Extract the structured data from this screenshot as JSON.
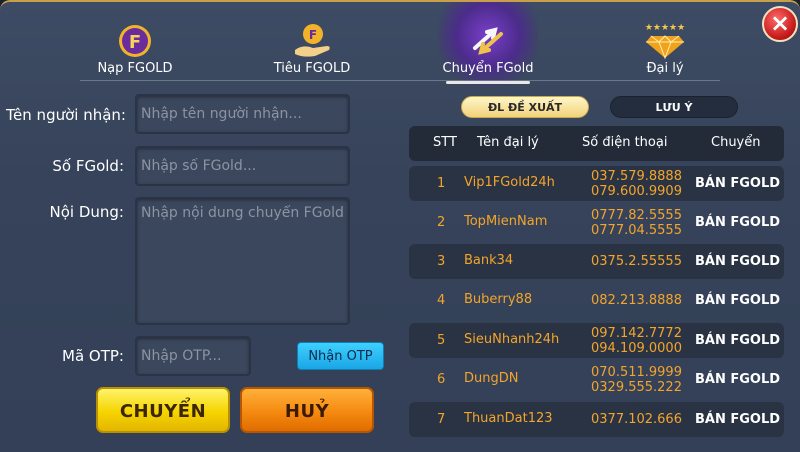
{
  "tabs": [
    {
      "label": "Nạp FGOLD",
      "icon": "fgold-coin-icon",
      "active": false
    },
    {
      "label": "Tiêu FGOLD",
      "icon": "hand-coin-icon",
      "active": false
    },
    {
      "label": "Chuyển FGold",
      "icon": "transfer-arrows-icon",
      "active": true
    },
    {
      "label": "Đại lý",
      "icon": "diamond-stars-icon",
      "active": false
    }
  ],
  "form": {
    "recipient": {
      "label": "Tên người nhận:",
      "placeholder": "Nhập tên người nhận..."
    },
    "amount": {
      "label": "Số FGold:",
      "placeholder": "Nhập số FGold..."
    },
    "content": {
      "label": "Nội Dung:",
      "placeholder": "Nhập nội dung chuyển FGold"
    },
    "otp": {
      "label": "Mã OTP:",
      "placeholder": "Nhập OTP...",
      "button": "Nhận OTP"
    },
    "submit": "CHUYỂN",
    "cancel": "HUỶ"
  },
  "subtabs": {
    "suggested": "ĐL ĐỀ XUẤT",
    "note": "LƯU Ý"
  },
  "table": {
    "headers": {
      "stt": "STT",
      "name": "Tên đại lý",
      "phone": "Số điện thoại",
      "action": "Chuyển"
    },
    "rows": [
      {
        "stt": "1",
        "name": "Vip1FGold24h",
        "phones": [
          "037.579.8888",
          "079.600.9909"
        ],
        "action": "BÁN FGOLD"
      },
      {
        "stt": "2",
        "name": "TopMienNam",
        "phones": [
          "0777.82.5555",
          "0777.04.5555"
        ],
        "action": "BÁN FGOLD"
      },
      {
        "stt": "3",
        "name": "Bank34",
        "phones": [
          "0375.2.55555"
        ],
        "action": "BÁN FGOLD"
      },
      {
        "stt": "4",
        "name": "Buberry88",
        "phones": [
          "082.213.8888"
        ],
        "action": "BÁN FGOLD"
      },
      {
        "stt": "5",
        "name": "SieuNhanh24h",
        "phones": [
          "097.142.7772",
          "094.109.0000"
        ],
        "action": "BÁN FGOLD"
      },
      {
        "stt": "6",
        "name": "DungDN",
        "phones": [
          "070.511.9999",
          "0329.555.222"
        ],
        "action": "BÁN FGOLD"
      },
      {
        "stt": "7",
        "name": "ThuanDat123",
        "phones": [
          "0377.102.666"
        ],
        "action": "BÁN FGOLD"
      }
    ]
  },
  "colors": {
    "accent_gold": "#f3a52b",
    "active_tab": "#7a3ecb",
    "otp_button": "#1aa6e6",
    "submit": "#f5d400",
    "cancel": "#f58a10"
  }
}
